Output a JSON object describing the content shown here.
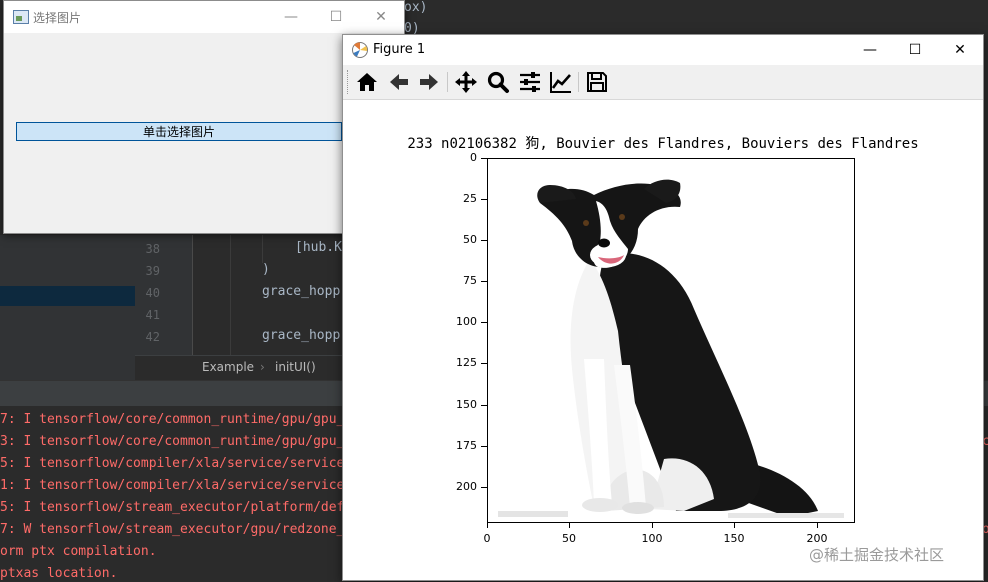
{
  "ide": {
    "top_fragments": [
      "ox)",
      "0)"
    ],
    "line_numbers": [
      "38",
      "39",
      "40",
      "41",
      "42"
    ],
    "code_lines": [
      "[hub.K",
      ")",
      "grace_hopp",
      "",
      "grace_hopp"
    ],
    "breadcrumb": [
      "Example",
      "initUI()"
    ],
    "log_lines": [
      "7: I tensorflow/core/common_runtime/gpu/gpu_",
      "3: I tensorflow/core/common_runtime/gpu/gpu_",
      "5: I tensorflow/compiler/xla/service/service",
      "1: I tensorflow/compiler/xla/service/service",
      "5: I tensorflow/stream_executor/platform/def",
      "7: W tensorflow/stream_executor/gpu/redzone_",
      "orm ptx compilation.",
      "ptxas location."
    ],
    "right_edge_chars": [
      "c",
      "o"
    ],
    "accent_log": "#ff6b68"
  },
  "dialog": {
    "title": "选择图片",
    "button_label": "单击选择图片",
    "controls": {
      "minimize": "—",
      "maximize": "☐",
      "close": "✕"
    }
  },
  "figure": {
    "title": "Figure 1",
    "controls": {
      "minimize": "—",
      "maximize": "☐",
      "close": "✕"
    },
    "toolbar": [
      "home-icon",
      "back-icon",
      "forward-icon",
      "pan-icon",
      "zoom-icon",
      "configure-subplots-icon",
      "edit-axes-icon",
      "save-icon"
    ],
    "plot_title": "233 n02106382 狗, Bouvier des Flandres, Bouviers des Flandres",
    "y_ticks": [
      "0",
      "25",
      "50",
      "75",
      "100",
      "125",
      "150",
      "175",
      "200"
    ],
    "x_ticks": [
      "0",
      "50",
      "100",
      "150",
      "200"
    ],
    "image_subject": "black-and-white dog sitting"
  },
  "watermark": "@稀土掘金技术社区"
}
